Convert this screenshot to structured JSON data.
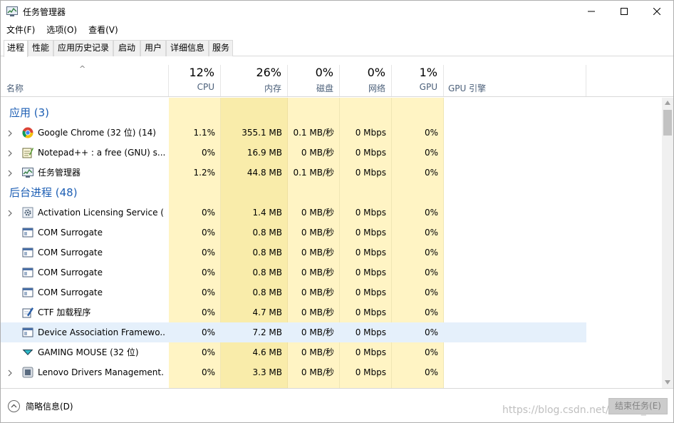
{
  "window": {
    "title": "任务管理器",
    "controls": [
      "minimize",
      "maximize",
      "close"
    ]
  },
  "menu": [
    "文件(F)",
    "选项(O)",
    "查看(V)"
  ],
  "tabs": [
    "进程",
    "性能",
    "应用历史记录",
    "启动",
    "用户",
    "详细信息",
    "服务"
  ],
  "active_tab": "进程",
  "header": {
    "name": "名称",
    "cpu": {
      "pct": "12%",
      "label": "CPU"
    },
    "mem": {
      "pct": "26%",
      "label": "内存"
    },
    "disk": {
      "pct": "0%",
      "label": "磁盘"
    },
    "net": {
      "pct": "0%",
      "label": "网络"
    },
    "gpu": {
      "pct": "1%",
      "label": "GPU"
    },
    "gpu_engine": "GPU 引擎"
  },
  "groups": {
    "apps": "应用 (3)",
    "background": "后台进程 (48)"
  },
  "apps": [
    {
      "name": "Google Chrome (32 位) (14)",
      "cpu": "1.1%",
      "mem": "355.1 MB",
      "disk": "0.1 MB/秒",
      "net": "0 Mbps",
      "gpu": "0%",
      "icon": "chrome-icon",
      "expandable": true
    },
    {
      "name": "Notepad++ : a free (GNU) s...",
      "cpu": "0%",
      "mem": "16.9 MB",
      "disk": "0 MB/秒",
      "net": "0 Mbps",
      "gpu": "0%",
      "icon": "notepad-icon",
      "expandable": true
    },
    {
      "name": "任务管理器",
      "cpu": "1.2%",
      "mem": "44.8 MB",
      "disk": "0.1 MB/秒",
      "net": "0 Mbps",
      "gpu": "0%",
      "icon": "taskmgr-icon",
      "expandable": true
    }
  ],
  "background": [
    {
      "name": "Activation Licensing Service (...",
      "cpu": "0%",
      "mem": "1.4 MB",
      "disk": "0 MB/秒",
      "net": "0 Mbps",
      "gpu": "0%",
      "icon": "gear-service-icon",
      "expandable": true
    },
    {
      "name": "COM Surrogate",
      "cpu": "0%",
      "mem": "0.8 MB",
      "disk": "0 MB/秒",
      "net": "0 Mbps",
      "gpu": "0%",
      "icon": "window-icon",
      "expandable": false
    },
    {
      "name": "COM Surrogate",
      "cpu": "0%",
      "mem": "0.8 MB",
      "disk": "0 MB/秒",
      "net": "0 Mbps",
      "gpu": "0%",
      "icon": "window-icon",
      "expandable": false
    },
    {
      "name": "COM Surrogate",
      "cpu": "0%",
      "mem": "0.8 MB",
      "disk": "0 MB/秒",
      "net": "0 Mbps",
      "gpu": "0%",
      "icon": "window-icon",
      "expandable": false
    },
    {
      "name": "COM Surrogate",
      "cpu": "0%",
      "mem": "0.8 MB",
      "disk": "0 MB/秒",
      "net": "0 Mbps",
      "gpu": "0%",
      "icon": "window-icon",
      "expandable": false
    },
    {
      "name": "CTF 加载程序",
      "cpu": "0%",
      "mem": "4.7 MB",
      "disk": "0 MB/秒",
      "net": "0 Mbps",
      "gpu": "0%",
      "icon": "ctf-pen-icon",
      "expandable": false
    },
    {
      "name": "Device Association Framewo...",
      "cpu": "0%",
      "mem": "7.2 MB",
      "disk": "0 MB/秒",
      "net": "0 Mbps",
      "gpu": "0%",
      "icon": "window-icon",
      "expandable": false,
      "selected": true
    },
    {
      "name": "GAMING MOUSE (32 位)",
      "cpu": "0%",
      "mem": "4.6 MB",
      "disk": "0 MB/秒",
      "net": "0 Mbps",
      "gpu": "0%",
      "icon": "gaming-mouse-icon",
      "expandable": false
    },
    {
      "name": "Lenovo Drivers Management...",
      "cpu": "0%",
      "mem": "3.3 MB",
      "disk": "0 MB/秒",
      "net": "0 Mbps",
      "gpu": "0%",
      "icon": "lenovo-icon",
      "expandable": true
    }
  ],
  "footer": {
    "less_details": "简略信息(D)",
    "end_task": "结束任务(E)",
    "watermark": "https://blog.csdn.net/weixin_..."
  },
  "colors": {
    "group_blue": "#1e5fb4",
    "heat_light": "#fff4c4",
    "heat_mid": "#f9ecaa",
    "header_label": "#4c607a",
    "selected_row": "#e5f0fb"
  }
}
